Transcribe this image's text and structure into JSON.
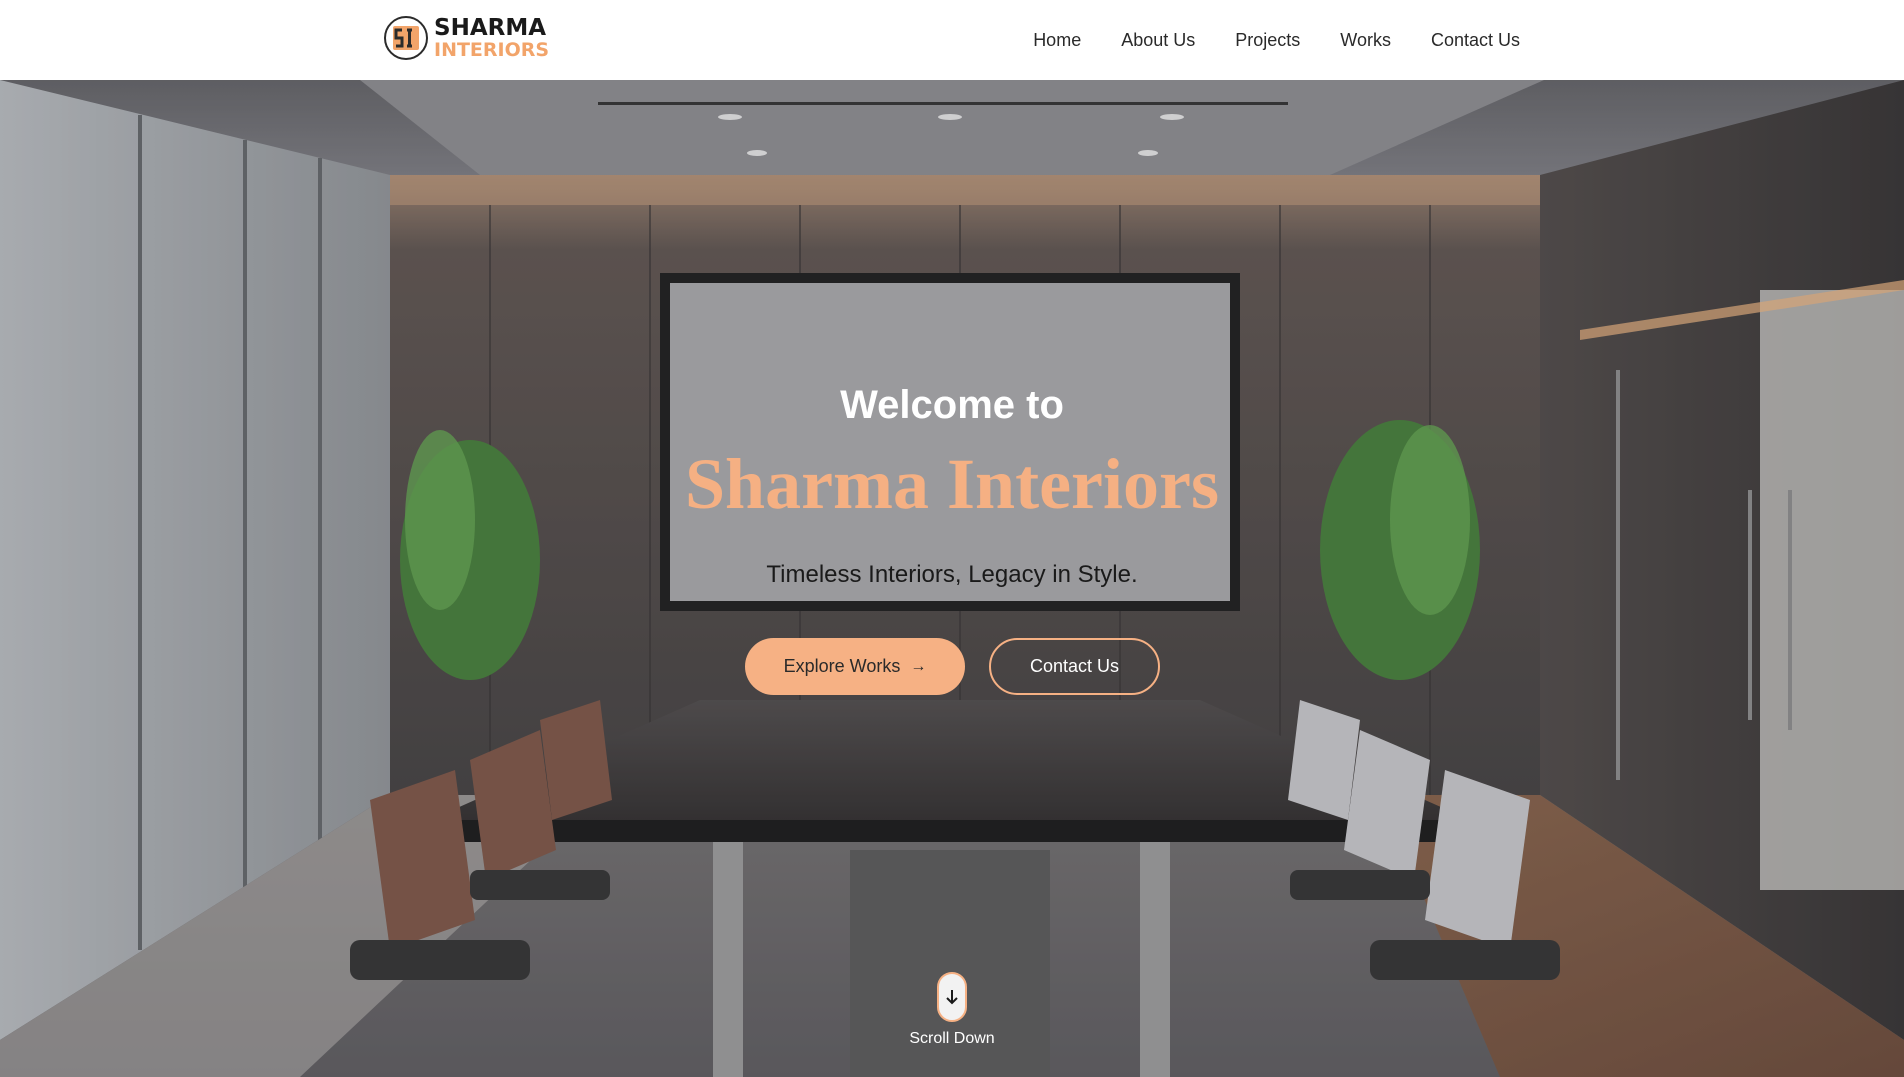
{
  "header": {
    "logo": {
      "line1": "SHARMA",
      "line2": "INTERIORS",
      "monogram": "SI"
    },
    "nav": [
      {
        "label": "Home"
      },
      {
        "label": "About Us"
      },
      {
        "label": "Projects"
      },
      {
        "label": "Works"
      },
      {
        "label": "Contact Us"
      }
    ]
  },
  "hero": {
    "welcome": "Welcome to",
    "brand": "Sharma Interiors",
    "tagline": "Timeless Interiors, Legacy in Style.",
    "primary_button": {
      "label": "Explore Works",
      "icon": "arrow-right-icon",
      "arrow": "→"
    },
    "secondary_button": {
      "label": "Contact Us"
    },
    "scroll": {
      "label": "Scroll Down",
      "icon": "arrow-down-icon"
    }
  },
  "colors": {
    "accent": "#f6b184",
    "header_bg": "#ffffff",
    "nav_text": "#2a2a2a"
  }
}
